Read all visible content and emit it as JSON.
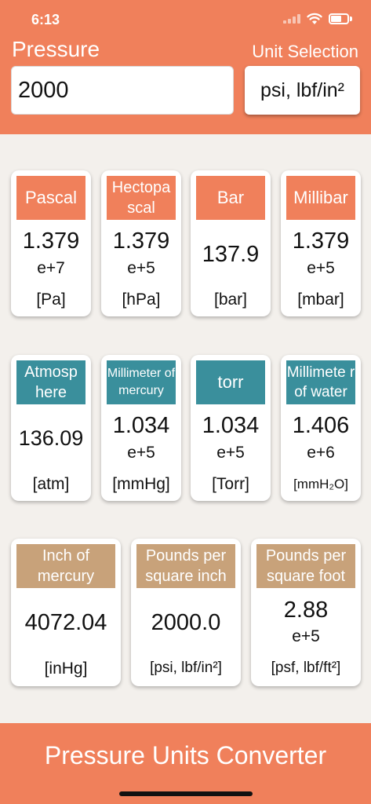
{
  "status_bar": {
    "time": "6:13"
  },
  "header": {
    "pressure_label": "Pressure",
    "unit_selection_label": "Unit Selection",
    "input_value": "2000",
    "selected_unit": "psi, lbf/in²"
  },
  "colors": {
    "accent": "#f0805b",
    "teal": "#3a8f9c",
    "tan": "#c8a27a",
    "background": "#f3f0ec"
  },
  "cards": [
    {
      "title": "Pascal",
      "value": "1.379",
      "exp": "e+7",
      "unit": "[Pa]"
    },
    {
      "title": "Hectopa scal",
      "value": "1.379",
      "exp": "e+5",
      "unit": "[hPa]"
    },
    {
      "title": "Bar",
      "value": "137.9",
      "exp": "",
      "unit": "[bar]"
    },
    {
      "title": "Millibar",
      "value": "1.379",
      "exp": "e+5",
      "unit": "[mbar]"
    },
    {
      "title": "Atmosp here",
      "value": "136.09",
      "exp": "",
      "unit": "[atm]"
    },
    {
      "title": "Millimeter of mercury",
      "value": "1.034",
      "exp": "e+5",
      "unit": "[mmHg]"
    },
    {
      "title": "torr",
      "value": "1.034",
      "exp": "e+5",
      "unit": "[Torr]"
    },
    {
      "title": "Millimete r of water",
      "value": "1.406",
      "exp": "e+6",
      "unit": "[mmH₂O]"
    },
    {
      "title": "Inch of mercury",
      "value": "4072.04",
      "exp": "",
      "unit": "[inHg]"
    },
    {
      "title": "Pounds per square inch",
      "value": "2000.0",
      "exp": "",
      "unit": "[psi, lbf/in²]"
    },
    {
      "title": "Pounds per square foot",
      "value": "2.88",
      "exp": "e+5",
      "unit": "[psf, lbf/ft²]"
    }
  ],
  "footer": {
    "title": "Pressure Units Converter"
  }
}
